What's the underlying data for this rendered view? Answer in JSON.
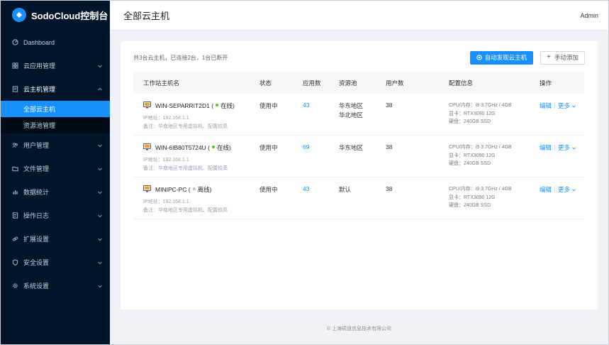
{
  "app": {
    "name": "SodoCloud控制台"
  },
  "header": {
    "title": "全部云主机",
    "user": "Admin"
  },
  "sidebar": {
    "items": [
      {
        "key": "dashboard",
        "label": "Dashboard",
        "icon": "dashboard-icon",
        "has_children": false
      },
      {
        "key": "apps",
        "label": "云应用管理",
        "icon": "grid-icon",
        "has_children": true
      },
      {
        "key": "hosts",
        "label": "云主机管理",
        "icon": "document-icon",
        "has_children": true,
        "expanded": true,
        "children": [
          {
            "label": "全部云主机",
            "active": true
          },
          {
            "label": "资源池管理",
            "active": false
          }
        ]
      },
      {
        "key": "users",
        "label": "用户管理",
        "icon": "users-icon",
        "has_children": true
      },
      {
        "key": "files",
        "label": "文件管理",
        "icon": "folder-icon",
        "has_children": true
      },
      {
        "key": "stats",
        "label": "数据统计",
        "icon": "bar-chart-icon",
        "has_children": true
      },
      {
        "key": "logs",
        "label": "操作日志",
        "icon": "log-icon",
        "has_children": true
      },
      {
        "key": "ext",
        "label": "扩展设置",
        "icon": "link-icon",
        "has_children": true
      },
      {
        "key": "security",
        "label": "安全设置",
        "icon": "shield-icon",
        "has_children": true
      },
      {
        "key": "system",
        "label": "系统设置",
        "icon": "gear-icon",
        "has_children": true
      }
    ]
  },
  "toolbar": {
    "summary": "共3台云主机，已连接2台，1台已断开",
    "discover_label": "自动发现云主机",
    "add_label": "手动添加"
  },
  "table": {
    "columns": [
      "工作站主机名",
      "状态",
      "应用数",
      "资源池",
      "用户数",
      "配置信息",
      "操作"
    ],
    "rows": [
      {
        "host": "WIN-SEPARRIT2D1",
        "conn": "在线",
        "conn_color": "#52c41a",
        "ip": "IP地址：192.168.1.1",
        "note": "备注：华南地区专用虚拟机、配置较高",
        "status": "使用中",
        "apps": "43",
        "pool": [
          "华东地区",
          "华北地区"
        ],
        "users": "38",
        "cfg": [
          "CPU/内存：i9 3.7GHz / 4GB",
          "显卡：RTX3090  12G",
          "硬盘：240GB SSD"
        ]
      },
      {
        "host": "WIN-6IB80T5724U",
        "conn": "在线",
        "conn_color": "#52c41a",
        "ip": "IP地址：192.168.1.1",
        "note": "备注：华南地区专用虚拟机、配置较高",
        "status": "使用中",
        "apps": "69",
        "pool": [
          "华东地区"
        ],
        "users": "38",
        "cfg": [
          "CPU/内存：i9 3.7GHz / 4GB",
          "显卡：RTX3090  12G",
          "硬盘：240GB SSD"
        ]
      },
      {
        "host": "MINIPC-PC",
        "conn": "离线",
        "conn_color": "#bfbfbf",
        "ip": "IP地址：192.168.1.1",
        "note": "备注：华南地区专用虚拟机、配置较高",
        "status": "使用中",
        "apps": "43",
        "pool": [
          "默认"
        ],
        "users": "38",
        "cfg": [
          "CPU/内存：i9 3.7GHz / 4GB",
          "显卡：RTX3090  12G",
          "硬盘：240GB SSD"
        ]
      }
    ],
    "ops": {
      "edit": "编辑",
      "more": "更多"
    }
  },
  "footer": {
    "text": "© 上海硕道信息技术有限公司"
  },
  "colors": {
    "sidebar_bg": "#001529",
    "accent": "#1890ff",
    "online": "#52c41a",
    "offline": "#bfbfbf"
  }
}
